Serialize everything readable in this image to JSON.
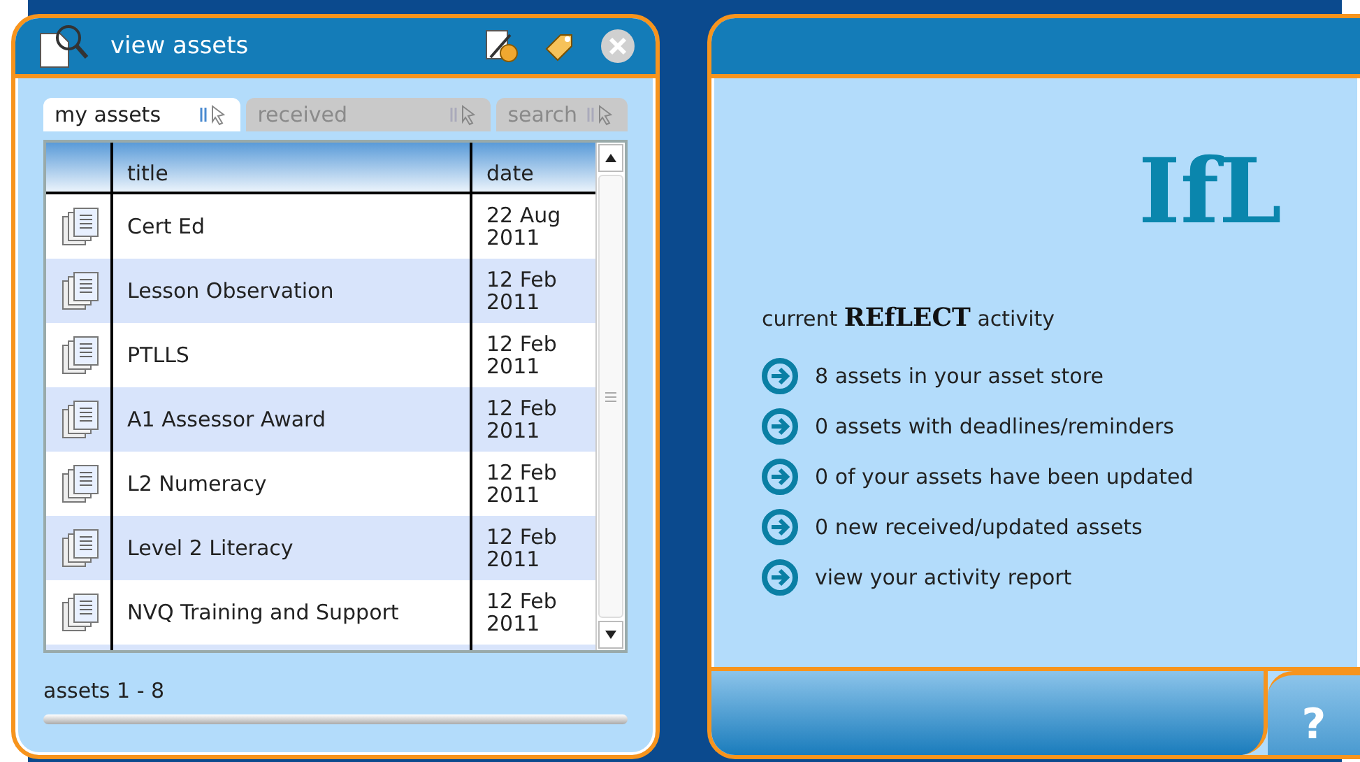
{
  "window": {
    "title": "view assets"
  },
  "tabs": [
    {
      "label": "my assets",
      "selected": true
    },
    {
      "label": "received",
      "selected": false
    },
    {
      "label": "search",
      "selected": false
    }
  ],
  "table": {
    "columns": [
      "title",
      "date"
    ],
    "rows": [
      {
        "title": "Cert Ed",
        "date": "22 Aug 2011"
      },
      {
        "title": "Lesson Observation",
        "date": "12 Feb 2011"
      },
      {
        "title": "PTLLS",
        "date": "12 Feb 2011"
      },
      {
        "title": "A1 Assessor Award",
        "date": "12 Feb 2011"
      },
      {
        "title": "L2 Numeracy",
        "date": "12 Feb 2011"
      },
      {
        "title": "Level 2 Literacy",
        "date": "12 Feb 2011"
      },
      {
        "title": "NVQ Training and Support",
        "date": "12 Feb 2011"
      }
    ]
  },
  "status": "assets 1 - 8",
  "logo": "IfL",
  "activity_heading": "current **REfLECT** activity",
  "activity_items": [
    "8 assets in your asset store",
    "0 assets with deadlines/reminders",
    "0 of your assets have been updated",
    "0 new received/updated assets",
    "view your activity report"
  ],
  "help": "?"
}
